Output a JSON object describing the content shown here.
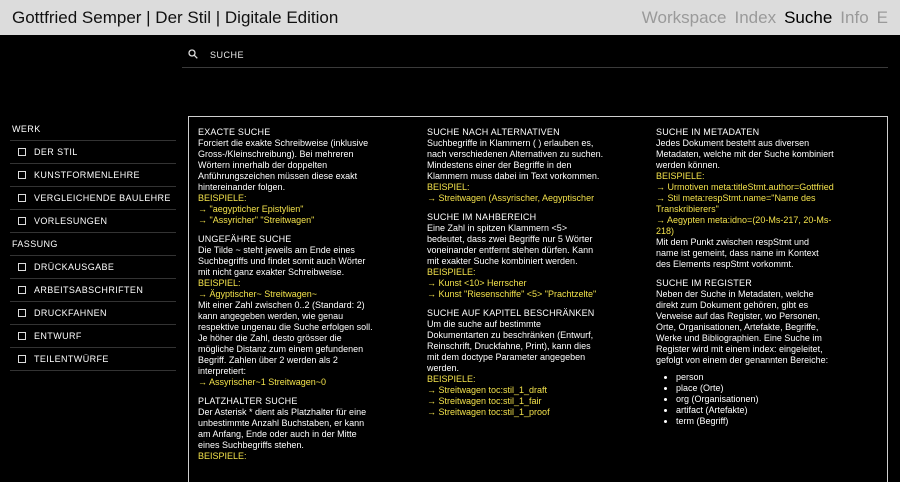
{
  "header": {
    "title": "Gottfried Semper | Der Stil | Digitale Edition",
    "nav": [
      "Workspace",
      "Index",
      "Suche",
      "Info",
      "E"
    ],
    "active": "Suche"
  },
  "search": {
    "label": "SUCHE"
  },
  "sidebar": {
    "groups": [
      {
        "heading": "WERK",
        "items": [
          "DER STIL",
          "KUNSTFORMENLEHRE",
          "VERGLEICHENDE BAULEHRE",
          "VORLESUNGEN"
        ]
      },
      {
        "heading": "FASSUNG",
        "items": [
          "DRÜCKAUSGABE",
          "ARBEITSABSCHRIFTEN",
          "DRUCKFAHNEN",
          "ENTWURF",
          "TEILENTWÜRFE"
        ]
      }
    ]
  },
  "help": {
    "columns": [
      [
        {
          "title": "EXACTE SUCHE",
          "text": "Forciert die exakte Schreibweise (inklusive Gross-/Kleinschreibung). Bei mehreren Wörtern innerhalb der doppelten Anführungszeichen müssen diese exakt hintereinander folgen.",
          "examples_label": "BEISPIELE:",
          "examples": [
            "→ \"aegypticher Epistylien\"",
            "→ \"Assyricher\" \"Streitwagen\""
          ]
        },
        {
          "title": "UNGEFÄHRE SUCHE",
          "text": "Die Tilde ~ steht jeweils am Ende eines Suchbegriffs und findet somit auch Wörter mit nicht ganz exakter Schreibweise.",
          "examples_label": "BEISPIEL:",
          "examples": [
            "→ Ägyptischer~ Streitwagen~"
          ],
          "text2": "Mit einer Zahl zwischen 0..2 (Standard: 2) kann angegeben werden, wie genau respektive ungenau die Suche erfolgen soll. Je höher die Zahl, desto grösser die mögliche Distanz zum einem gefundenen Begriff. Zahlen über 2 werden als 2 interpretiert:",
          "examples2": [
            "→ Assyrischer~1 Streitwagen~0"
          ]
        },
        {
          "title": "PLATZHALTER SUCHE",
          "text": "Der Asterisk * dient als Platzhalter für eine unbestimmte Anzahl Buchstaben, er kann am Anfang, Ende oder auch in der Mitte eines Suchbegriffs stehen.",
          "examples_label": "BEISPIELE:",
          "examples": []
        }
      ],
      [
        {
          "title": "SUCHE NACH ALTERNATIVEN",
          "text": "Suchbegriffe in Klammern ( ) erlauben es, nach verschiedenen Alternativen zu suchen. Mindestens einer der Begriffe in den Klammern muss dabei im Text vorkommen.",
          "examples_label": "BEISPIEL:",
          "examples": [
            "→ Streitwagen (Assyrischer, Aegyptischer"
          ]
        },
        {
          "title": "SUCHE IM NAHBEREICH",
          "text": "Eine Zahl in spitzen Klammern <5> bedeutet, dass zwei Begriffe nur 5 Wörter voneinander entfernt stehen dürfen. Kann mit exakter Suche kombiniert werden.",
          "examples_label": "BEISPIELE:",
          "examples": [
            "→ Kunst <10> Herrscher",
            "→ Kunst \"Riesenschiffe\" <5> \"Prachtzelte\""
          ]
        },
        {
          "title": "SUCHE AUF KAPITEL BESCHRÄNKEN",
          "text": "Um die suche auf bestimmte Dokumentarten zu beschränken (Entwurf, Reinschrift, Druckfahne, Print), kann dies mit dem doctype Parameter angegeben werden.",
          "examples_label": "BEISPIELE:",
          "examples": [
            "→ Streitwagen toc:stil_1_draft",
            "→ Streitwagen toc:stil_1_fair",
            "→ Streitwagen toc:stil_1_proof"
          ]
        }
      ],
      [
        {
          "title": "SUCHE IN METADATEN",
          "text": "Jedes Dokument besteht aus diversen Metadaten, welche mit der Suche kombiniert werden können.",
          "examples_label": "BEISPIELE:",
          "examples": [
            "→ Urmotiven meta:titleStmt.author=Gottfried",
            "→ Stil meta:respStmt.name=\"Name des Transkribierers\"",
            "→ Aegypten meta:idno=(20-Ms-217, 20-Ms-218)"
          ],
          "text2": "Mit dem Punkt zwischen respStmt und name ist gemeint, dass name im Kontext des Elements respStmt vorkommt."
        },
        {
          "title": "SUCHE IM REGISTER",
          "text": "Neben der Suche in Metadaten, welche direkt zum Dokument gehören, gibt es Verweise auf das Register, wo Personen, Orte, Organisationen, Artefakte, Begriffe, Werke und Bibliographien. Eine Suche im Register wird mit einem index: eingeleitet, gefolgt von einem der genannten Bereiche:",
          "list": [
            "person",
            "place (Orte)",
            "org (Organisationen)",
            "artifact (Artefakte)",
            "term (Begriff)"
          ]
        }
      ]
    ]
  }
}
